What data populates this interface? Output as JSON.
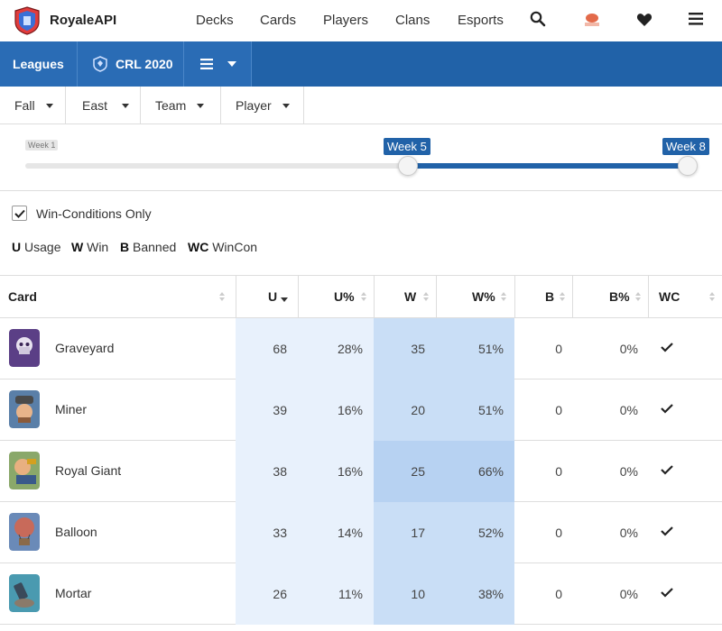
{
  "nav": {
    "brand": "RoyaleAPI",
    "links": [
      "Decks",
      "Cards",
      "Players",
      "Clans",
      "Esports"
    ]
  },
  "subnav": {
    "leagues": "Leagues",
    "season": "CRL 2020"
  },
  "filters": [
    "Fall",
    "East",
    "Team",
    "Player"
  ],
  "slider": {
    "start_label": "Week 1",
    "from_label": "Week 5",
    "to_label": "Week 8",
    "from_week": 5,
    "to_week": 8,
    "min_week": 1,
    "max_week": 8
  },
  "options": {
    "win_conditions_label": "Win-Conditions Only",
    "win_conditions_checked": true
  },
  "legend": [
    {
      "key": "U",
      "label": "Usage"
    },
    {
      "key": "W",
      "label": "Win"
    },
    {
      "key": "B",
      "label": "Banned"
    },
    {
      "key": "WC",
      "label": "WinCon"
    }
  ],
  "table": {
    "headers": [
      "Card",
      "U",
      "U%",
      "W",
      "W%",
      "B",
      "B%",
      "WC"
    ],
    "rows": [
      {
        "card": "Graveyard",
        "u": "68",
        "u_pct": "28%",
        "w": "35",
        "w_pct": "51%",
        "b": "0",
        "b_pct": "0%"
      },
      {
        "card": "Miner",
        "u": "39",
        "u_pct": "16%",
        "w": "20",
        "w_pct": "51%",
        "b": "0",
        "b_pct": "0%"
      },
      {
        "card": "Royal Giant",
        "u": "38",
        "u_pct": "16%",
        "w": "25",
        "w_pct": "66%",
        "b": "0",
        "b_pct": "0%"
      },
      {
        "card": "Balloon",
        "u": "33",
        "u_pct": "14%",
        "w": "17",
        "w_pct": "52%",
        "b": "0",
        "b_pct": "0%"
      },
      {
        "card": "Mortar",
        "u": "26",
        "u_pct": "11%",
        "w": "10",
        "w_pct": "38%",
        "b": "0",
        "b_pct": "0%"
      }
    ]
  },
  "colors": {
    "primary": "#2162a8",
    "usage_bg": "#e8f1fc",
    "win_bg": "#c9def6"
  }
}
